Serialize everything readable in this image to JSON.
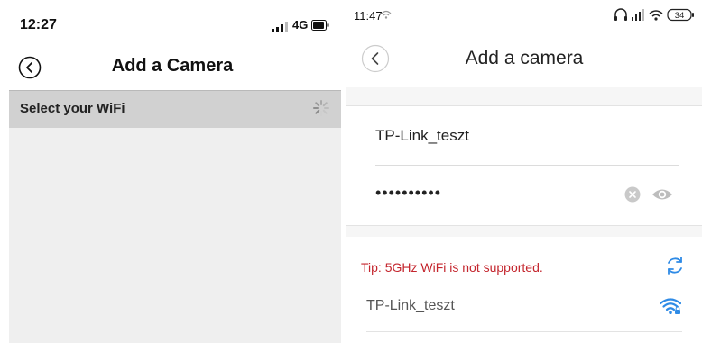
{
  "left": {
    "status": {
      "time": "12:27",
      "network": "4G"
    },
    "title": "Add a Camera",
    "wifi_header": "Select your WiFi"
  },
  "right": {
    "status": {
      "time": "11:47",
      "battery": "34"
    },
    "title": "Add a camera",
    "ssid_value": "TP-Link_teszt",
    "password_masked": "••••••••••",
    "tip": "Tip: 5GHz WiFi is not supported.",
    "networks": [
      {
        "name": "TP-Link_teszt"
      }
    ]
  },
  "colors": {
    "tip_red": "#c4262e",
    "accent_blue": "#2f8be6"
  }
}
